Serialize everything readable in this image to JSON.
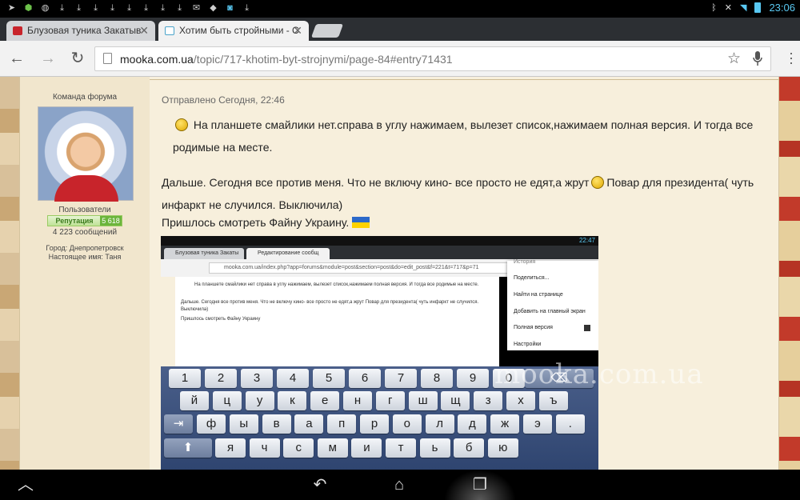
{
  "status_bar": {
    "clock": "23:06",
    "left_icons": [
      "telegram-icon",
      "shield-icon",
      "globe-icon",
      "download-icon",
      "download-icon",
      "download-icon",
      "download-icon",
      "download-icon",
      "download-icon",
      "download-icon",
      "download-icon",
      "gmail-icon",
      "app-icon",
      "app-icon",
      "download-icon"
    ],
    "right_icons": [
      "bluetooth-icon",
      "no-vibrate-icon",
      "wifi-icon",
      "battery-icon"
    ]
  },
  "tabs": [
    {
      "title": "Блузовая туника Закатыв",
      "active": false
    },
    {
      "title": "Хотим быть стройными - С",
      "active": true
    }
  ],
  "toolbar": {
    "url_domain": "mooka.com.ua",
    "url_path": "/topic/717-khotim-byt-strojnymi/page-84#entry71431"
  },
  "author": {
    "team": "Команда форума",
    "group": "Пользователи",
    "reputation_label": "Репутация",
    "reputation_value": "5 618",
    "messages": "4 223 сообщений",
    "city": "Город: Днепропетровск",
    "real_name": "Настоящее имя: Таня"
  },
  "post": {
    "posted": "Отправлено Сегодня, 22:46",
    "p1": "На планшете смайлики нет.справа в углу нажимаем, вылезет список,нажимаем полная версия. И тогда все родимые на месте.",
    "p2a": "Дальше. Сегодня все против меня. Что не включу кино- все просто не едят,а жрут",
    "p2b": "Повар для президента( чуть инфаркт не случился. Выключила)",
    "p3": "Пришлось смотреть Файну Украину."
  },
  "screenshot": {
    "clock": "22:47",
    "tab1": "Блузовая туника Закаты",
    "tab2": "Редактирование сообщ",
    "url": "mooka.com.ua/index.php?app=forums&module=post&section=post&do=edit_post&f=221&t=717&p=71",
    "line1": "На планшете смайлики нет справа в углу нажимаем, вылезет список,нажимаем полная версия. И тогда все родимые на месте.",
    "line2": "Дальше. Сегодня все против меня. Что не включу кино- все просто не едят,а жрут Повар для президента( чуть инфаркт не случился.",
    "line3": "Выключила)",
    "line4": "Пришлось смотреть Файну Украину",
    "menu": [
      "История",
      "Поделиться...",
      "Найти на странице",
      "Добавить на главный экран",
      "Полная версия",
      "Настройки"
    ],
    "keys_row1": [
      "1",
      "2",
      "3",
      "4",
      "5",
      "6",
      "7",
      "8",
      "9",
      "0"
    ],
    "keys_row2": [
      "й",
      "ц",
      "у",
      "к",
      "е",
      "н",
      "г",
      "ш",
      "щ",
      "з",
      "х",
      "ъ"
    ],
    "keys_row3": [
      "ф",
      "ы",
      "в",
      "а",
      "п",
      "р",
      "о",
      "л",
      "д",
      "ж",
      "э",
      "."
    ],
    "keys_row4": [
      "я",
      "ч",
      "с",
      "м",
      "и",
      "т",
      "ь",
      "б",
      "ю"
    ]
  },
  "watermark": "mooka.com.ua"
}
